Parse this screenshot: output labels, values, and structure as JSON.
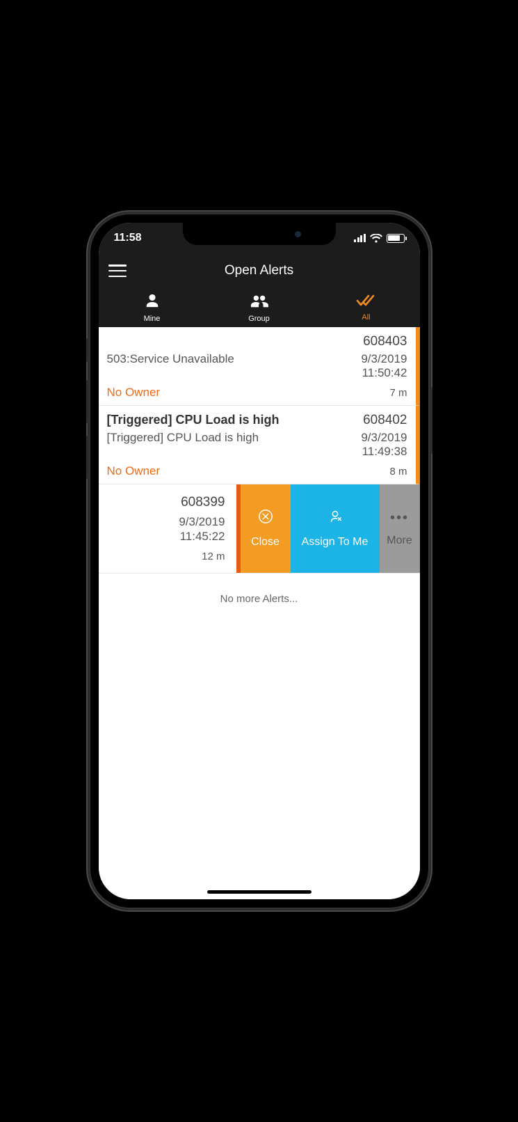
{
  "status": {
    "time": "11:58"
  },
  "nav": {
    "title": "Open Alerts"
  },
  "tabs": {
    "mine": "Mine",
    "group": "Group",
    "all": "All"
  },
  "alerts": [
    {
      "id": "608403",
      "desc": "503:Service Unavailable",
      "date": "9/3/2019",
      "time": "11:50:42",
      "owner": "No Owner",
      "age": "7 m"
    },
    {
      "id": "608402",
      "title": "[Triggered] CPU Load is high",
      "desc": "[Triggered] CPU Load is high",
      "date": "9/3/2019",
      "time": "11:49:38",
      "owner": "No Owner",
      "age": "8 m"
    },
    {
      "id": "608399",
      "date": "9/3/2019",
      "time": "11:45:22",
      "age": "12 m"
    }
  ],
  "swipe": {
    "close": "Close",
    "assign": "Assign To Me",
    "more": "More"
  },
  "footer": {
    "no_more": "No more Alerts..."
  }
}
